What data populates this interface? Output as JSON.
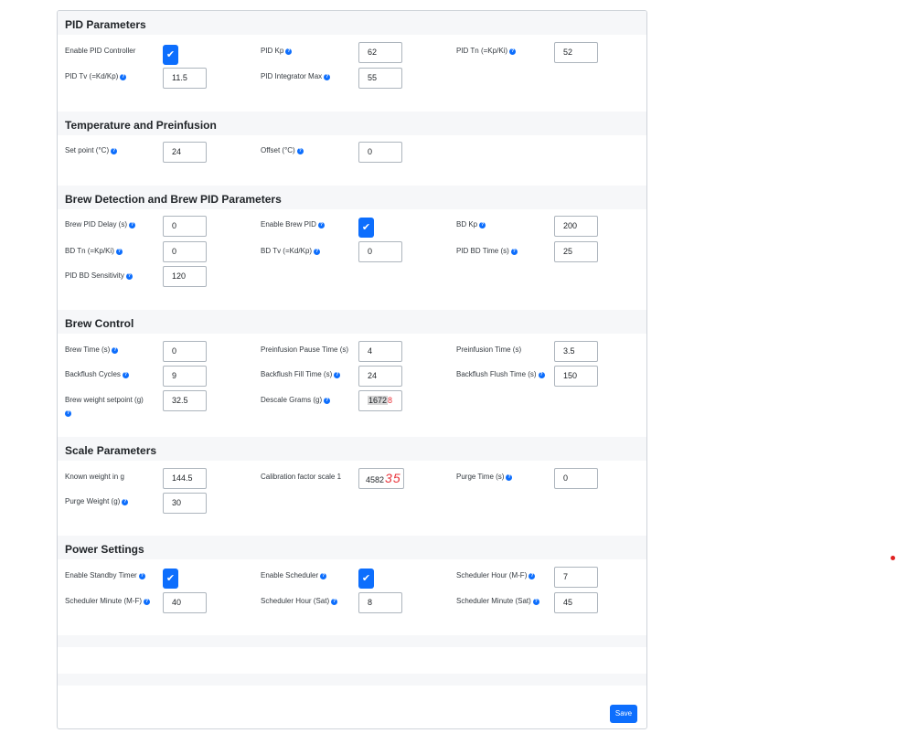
{
  "sections": {
    "pid": {
      "title": "PID Parameters",
      "enable_pid": "Enable PID Controller",
      "kp_label": "PID Kp",
      "kp": "62",
      "tn_label": "PID Tn (=Kp/Ki)",
      "tn": "52",
      "tv_label": "PID Tv (=Kd/Kp)",
      "tv": "11.5",
      "imax_label": "PID Integrator Max",
      "imax": "55"
    },
    "temp": {
      "title": "Temperature and Preinfusion",
      "setpoint_label": "Set point (°C)",
      "setpoint": "24",
      "offset_label": "Offset (°C)",
      "offset": "0"
    },
    "brewdetect": {
      "title": "Brew Detection and Brew PID Parameters",
      "delay_label": "Brew PID Delay (s)",
      "delay": "0",
      "enable_label": "Enable Brew PID",
      "bdkp_label": "BD Kp",
      "bdkp": "200",
      "bdtn_label": "BD Tn (=Kp/Ki)",
      "bdtn": "0",
      "bdtv_label": "BD Tv (=Kd/Kp)",
      "bdtv": "0",
      "bdtime_label": "PID BD Time (s)",
      "bdtime": "25",
      "sens_label": "PID BD Sensitivity",
      "sens": "120"
    },
    "brew": {
      "title": "Brew Control",
      "brewtime_label": "Brew Time (s)",
      "brewtime": "0",
      "pausetime_label": "Preinfusion Pause Time (s)",
      "pausetime": "4",
      "pretime_label": "Preinfusion Time (s)",
      "pretime": "3.5",
      "bfcycles_label": "Backflush Cycles",
      "bfcycles": "9",
      "bffill_label": "Backflush Fill Time (s)",
      "bffill": "24",
      "bfflush_label": "Backflush Flush Time (s)",
      "bfflush": "150",
      "weight_label": "Brew weight setpoint (g)",
      "weight": "32.5",
      "descale_label": "Descale Grams (g)",
      "descale_sel": "1672",
      "descale_tail": "8"
    },
    "scale": {
      "title": "Scale Parameters",
      "known_label": "Known weight in g",
      "known": "144.5",
      "cal_label": "Calibration factor scale 1",
      "cal": "4582",
      "cal_scribble": "35",
      "purge_label": "Purge Time (s)",
      "purge": "0",
      "pweight_label": "Purge Weight (g)",
      "pweight": "30"
    },
    "power": {
      "title": "Power Settings",
      "standby_label": "Enable Standby Timer",
      "sched_label": "Enable Scheduler",
      "hour_mf_label": "Scheduler Hour (M-F)",
      "hour_mf": "7",
      "min_mf_label": "Scheduler Minute (M-F)",
      "min_mf": "40",
      "hour_sat_label": "Scheduler Hour (Sat)",
      "hour_sat": "8",
      "min_sat_label": "Scheduler Minute (Sat)",
      "min_sat": "45"
    }
  },
  "save_label": "Save",
  "help_glyph": "?",
  "check_glyph": "✔",
  "colors": {
    "accent": "#0d6efd",
    "section_bg": "#f6f7f9",
    "annotation": "#e8333a"
  }
}
